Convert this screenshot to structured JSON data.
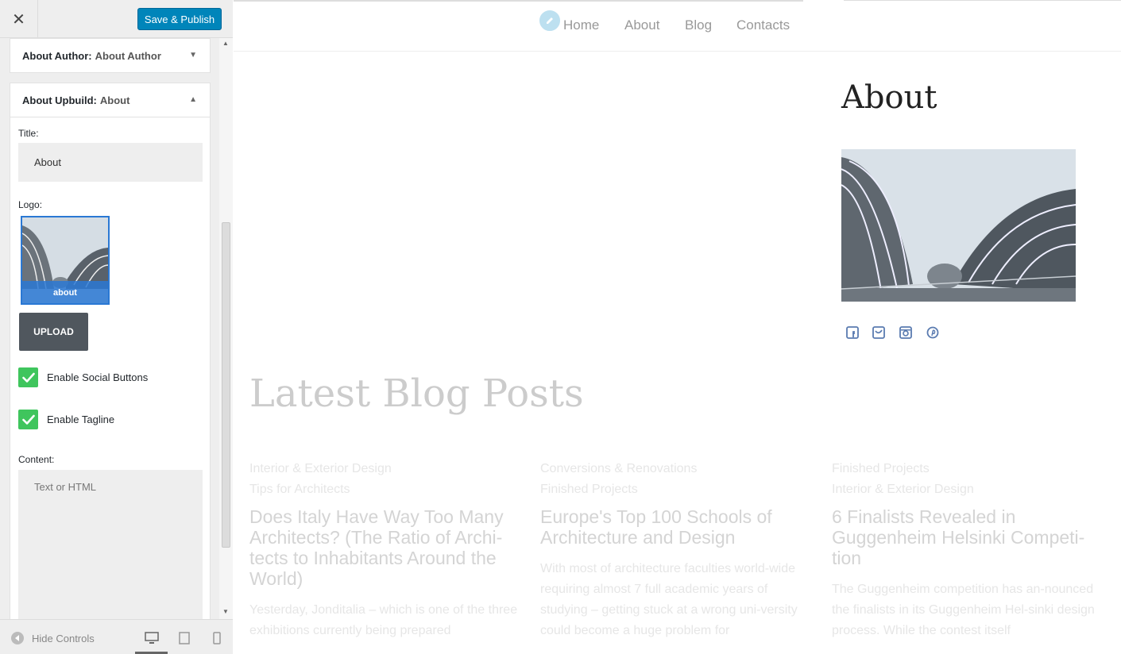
{
  "sidebar": {
    "close_icon": "close-icon",
    "save_label": "Save & Publish",
    "widget_author": {
      "label": "About Author:",
      "sub": "About Author"
    },
    "widget_upbuild": {
      "label": "About Upbuild:",
      "sub": "About"
    },
    "title_label": "Title:",
    "title_value": "About",
    "logo_label": "Logo:",
    "logo_caption": "about",
    "upload_label": "UPLOAD",
    "social_label": "Enable Social Buttons",
    "tagline_label": "Enable Tagline",
    "content_label": "Content:",
    "content_placeholder": "Text or HTML",
    "hide_controls_label": "Hide Controls",
    "social_checked": true,
    "tagline_checked": true
  },
  "preview": {
    "nav": [
      "Home",
      "About",
      "Blog",
      "Contacts"
    ],
    "about_title": "About",
    "blog_heading": "Latest Blog Posts",
    "posts": [
      {
        "cat1": "Interior & Exterior Design",
        "cat2": "Tips for Architects",
        "title": "Does Italy Have Way Too Many Architects? (The Ratio of Archi-tects to Inhabitants Around the World)",
        "excerpt": "Yesterday, Jonditalia – which is one of the three exhibitions currently being prepared"
      },
      {
        "cat1": "Conversions & Renovations",
        "cat2": "Finished Projects",
        "title": "Europe's Top 100 Schools of Architecture and Design",
        "excerpt": "With most of architecture faculties world-wide requiring almost 7 full academic years of studying – getting stuck at a wrong uni-versity could become a huge problem for"
      },
      {
        "cat1": "Finished Projects",
        "cat2": "Interior & Exterior Design",
        "title": "6 Finalists Revealed in Guggenheim Helsinki Competi-tion",
        "excerpt": "The Guggenheim competition has an-nounced the finalists in its Guggenheim Hel-sinki design process. While the contest itself"
      }
    ]
  },
  "colors": {
    "primary_button": "#0085ba",
    "checkbox": "#3fc55d",
    "upload_button": "#50575e",
    "social_icon": "#5a7bb0"
  }
}
